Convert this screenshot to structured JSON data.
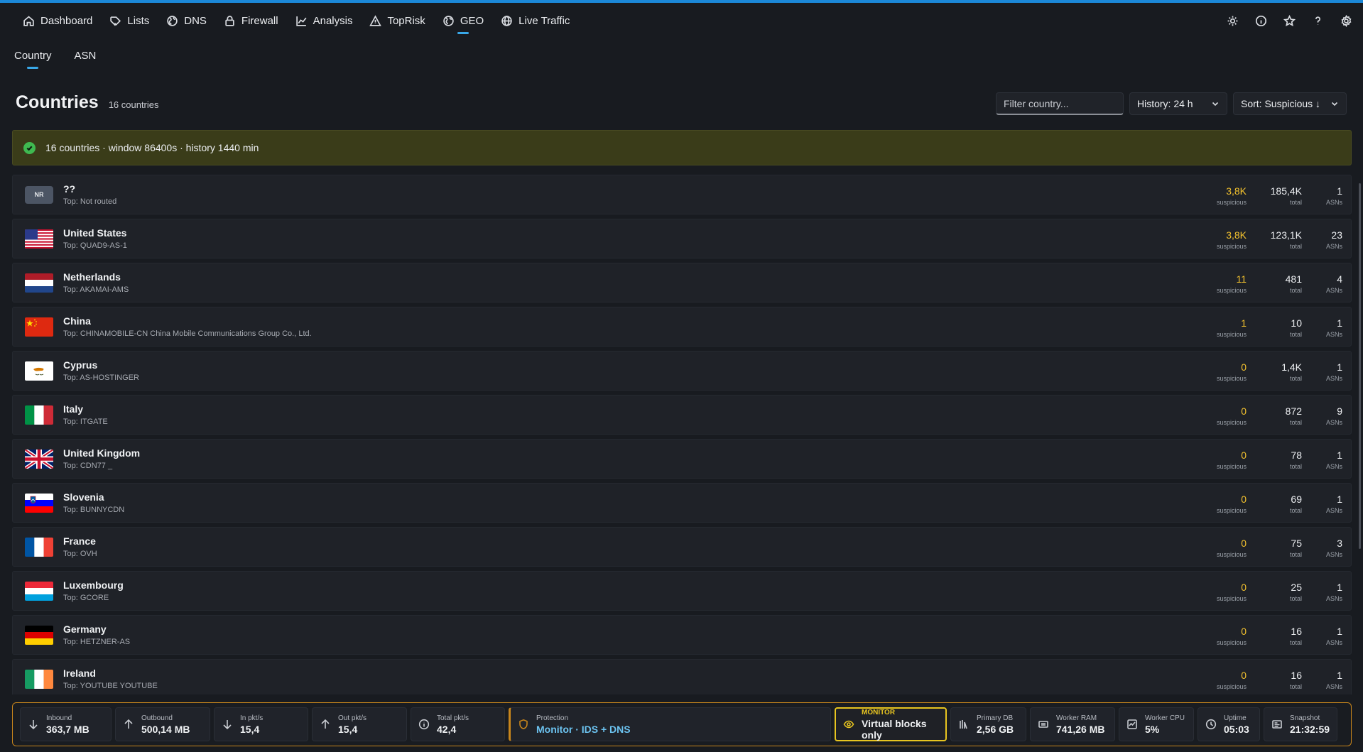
{
  "nav": {
    "items": [
      {
        "label": "Dashboard",
        "icon": "home-icon"
      },
      {
        "label": "Lists",
        "icon": "tag-icon"
      },
      {
        "label": "DNS",
        "icon": "globe-icon"
      },
      {
        "label": "Firewall",
        "icon": "lock-icon"
      },
      {
        "label": "Analysis",
        "icon": "chart-icon"
      },
      {
        "label": "TopRisk",
        "icon": "warning-icon"
      },
      {
        "label": "GEO",
        "icon": "earth-icon"
      },
      {
        "label": "Live Traffic",
        "icon": "web-icon"
      }
    ],
    "active": "GEO",
    "right_icons": [
      "sun-icon",
      "info-icon",
      "star-icon",
      "help-icon",
      "settings-icon"
    ]
  },
  "subtabs": {
    "country": "Country",
    "asn": "ASN",
    "active": "Country"
  },
  "header": {
    "title": "Countries",
    "count": "16 countries",
    "filter_placeholder": "Filter country...",
    "history": "History: 24 h",
    "sort": "Sort: Suspicious ↓"
  },
  "info": {
    "text": "16 countries · window 86400s · history 1440 min"
  },
  "labels": {
    "suspicious": "suspicious",
    "total": "total",
    "asns": "ASNs"
  },
  "countries": [
    {
      "name": "??",
      "top": "Top: Not routed",
      "suspicious": "3,8K",
      "total": "185,4K",
      "asns": "1",
      "flag": "NR"
    },
    {
      "name": "United States",
      "top": "Top: QUAD9-AS-1",
      "suspicious": "3,8K",
      "total": "123,1K",
      "asns": "23",
      "flag": "us"
    },
    {
      "name": "Netherlands",
      "top": "Top: AKAMAI-AMS",
      "suspicious": "11",
      "total": "481",
      "asns": "4",
      "flag": "nl"
    },
    {
      "name": "China",
      "top": "Top: CHINAMOBILE-CN China Mobile Communications Group Co., Ltd.",
      "suspicious": "1",
      "total": "10",
      "asns": "1",
      "flag": "cn"
    },
    {
      "name": "Cyprus",
      "top": "Top: AS-HOSTINGER",
      "suspicious": "0",
      "total": "1,4K",
      "asns": "1",
      "flag": "cy"
    },
    {
      "name": "Italy",
      "top": "Top: ITGATE",
      "suspicious": "0",
      "total": "872",
      "asns": "9",
      "flag": "it"
    },
    {
      "name": "United Kingdom",
      "top": "Top: CDN77 _",
      "suspicious": "0",
      "total": "78",
      "asns": "1",
      "flag": "gb"
    },
    {
      "name": "Slovenia",
      "top": "Top: BUNNYCDN",
      "suspicious": "0",
      "total": "69",
      "asns": "1",
      "flag": "si"
    },
    {
      "name": "France",
      "top": "Top: OVH",
      "suspicious": "0",
      "total": "75",
      "asns": "3",
      "flag": "fr"
    },
    {
      "name": "Luxembourg",
      "top": "Top: GCORE",
      "suspicious": "0",
      "total": "25",
      "asns": "1",
      "flag": "lu"
    },
    {
      "name": "Germany",
      "top": "Top: HETZNER-AS",
      "suspicious": "0",
      "total": "16",
      "asns": "1",
      "flag": "de"
    },
    {
      "name": "Ireland",
      "top": "Top: YOUTUBE YOUTUBE",
      "suspicious": "0",
      "total": "16",
      "asns": "1",
      "flag": "ie"
    }
  ],
  "status": {
    "inbound": {
      "label": "Inbound",
      "value": "363,7 MB"
    },
    "outbound": {
      "label": "Outbound",
      "value": "500,14 MB"
    },
    "in_pkt": {
      "label": "In pkt/s",
      "value": "15,4"
    },
    "out_pkt": {
      "label": "Out pkt/s",
      "value": "15,4"
    },
    "total_pkt": {
      "label": "Total pkt/s",
      "value": "42,4"
    },
    "protection": {
      "label": "Protection",
      "value": "Monitor · IDS + DNS"
    },
    "monitor": {
      "label": "MONITOR",
      "value": "Virtual blocks only"
    },
    "primary_db": {
      "label": "Primary DB",
      "value": "2,56 GB"
    },
    "worker_ram": {
      "label": "Worker RAM",
      "value": "741,26 MB"
    },
    "worker_cpu": {
      "label": "Worker CPU",
      "value": "5%"
    },
    "uptime": {
      "label": "Uptime",
      "value": "05:03"
    },
    "snapshot": {
      "label": "Snapshot",
      "value": "21:32:59"
    }
  },
  "colors": {
    "accent": "#39a8e8",
    "suspicious": "#f2c12e",
    "info_bg": "#3a3c19",
    "status_border": "#c8861c",
    "monitor": "#e8c520"
  }
}
